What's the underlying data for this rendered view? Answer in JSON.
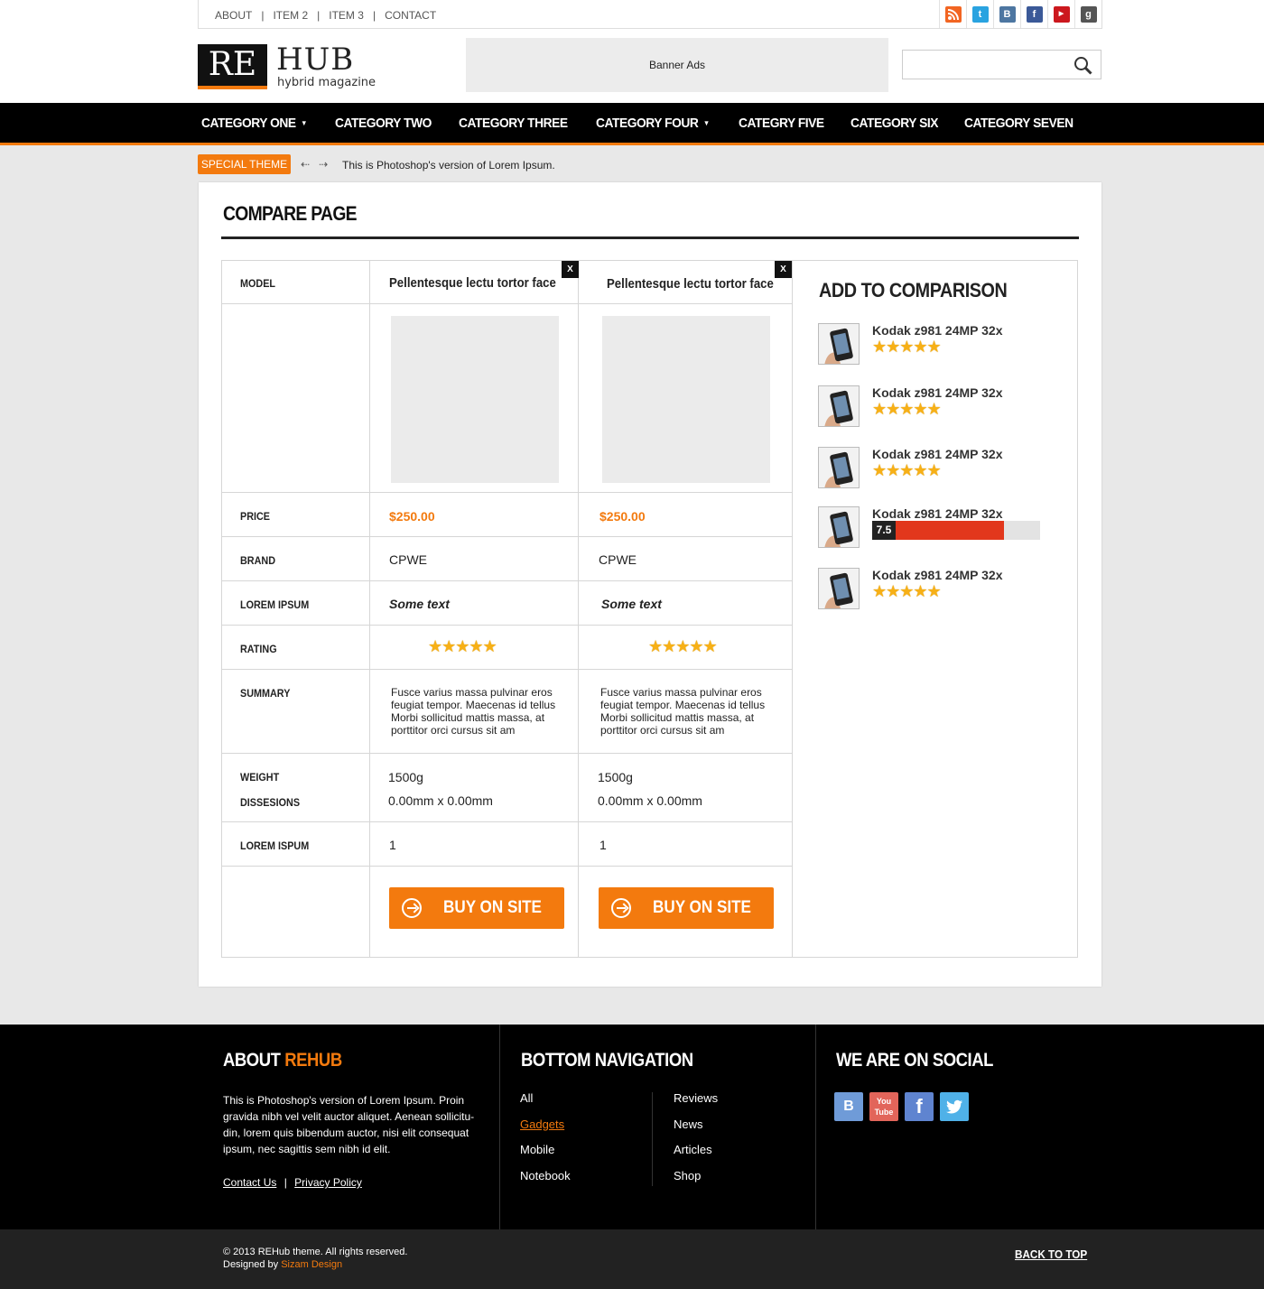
{
  "topbar": {
    "links": [
      "ABOUT",
      "ITEM 2",
      "ITEM 3",
      "CONTACT"
    ],
    "socials": [
      {
        "icon": "rss-icon",
        "color": "#f26522"
      },
      {
        "icon": "twitter-icon",
        "color": "#2aa3e0"
      },
      {
        "icon": "vk-icon",
        "color": "#4d76a1"
      },
      {
        "icon": "facebook-icon",
        "color": "#3b5998"
      },
      {
        "icon": "youtube-icon",
        "color": "#cc181e"
      },
      {
        "icon": "google-plus-icon",
        "color": "#555555"
      }
    ]
  },
  "header": {
    "logo_left": "RE",
    "logo_right": "HUB",
    "tagline": "hybrid magazine",
    "banner": "Banner Ads",
    "search_placeholder": ""
  },
  "nav": {
    "items": [
      {
        "label": "CATEGORY ONE",
        "has_dropdown": true
      },
      {
        "label": "CATEGORY TWO",
        "has_dropdown": false
      },
      {
        "label": "CATEGORY THREE",
        "has_dropdown": false
      },
      {
        "label": "CATEGORY FOUR",
        "has_dropdown": true
      },
      {
        "label": "CATEGRY FIVE",
        "has_dropdown": false
      },
      {
        "label": "CATEGORY SIX",
        "has_dropdown": false
      },
      {
        "label": "CATEGORY SEVEN",
        "has_dropdown": false
      }
    ]
  },
  "ticker": {
    "badge": "SPECIAL THEME",
    "text": "This is Photoshop's version  of Lorem Ipsum."
  },
  "compare": {
    "title": "COMPARE PAGE",
    "labels": {
      "model": "MODEL",
      "price": "PRICE",
      "brand": "BRAND",
      "lorem_ipsum": "LOREM IPSUM",
      "rating": "RATING",
      "summary": "SUMMARY",
      "weight": "WEIGHT",
      "dimensions": "DISSESIONS",
      "lorem_ispum": "LOREM ISPUM"
    },
    "products": [
      {
        "close": "X",
        "model": "Pellentesque lectu tortor face",
        "price": "$250.00",
        "brand": "CPWE",
        "lorem": "Some text",
        "stars": "★★★★★",
        "summary": "Fusce varius massa pulvinar eros feugiat tempor. Maecenas id tellus Morbi sollicitud mattis massa, at porttitor orci cursus sit am",
        "weight": "1500g",
        "dimensions": "0.00mm x 0.00mm",
        "lorem_ispum": "1",
        "buy": "BUY ON SITE"
      },
      {
        "close": "X",
        "model": "Pellentesque lectu tortor face",
        "price": "$250.00",
        "brand": "CPWE",
        "lorem": "Some text",
        "stars": "★★★★★",
        "summary": "Fusce varius massa pulvinar eros feugiat tempor. Maecenas id tellus Morbi sollicitud mattis massa, at porttitor orci cursus sit am",
        "weight": "1500g",
        "dimensions": "0.00mm x 0.00mm",
        "lorem_ispum": "1",
        "buy": "BUY ON SITE"
      }
    ]
  },
  "add_to_comparison": {
    "title": "ADD TO COMPARISON",
    "items": [
      {
        "name": "Kodak z981 24MP 32x",
        "stars": "★★★★★"
      },
      {
        "name": "Kodak z981 24MP 32x",
        "stars": "★★★★★"
      },
      {
        "name": "Kodak z981 24MP 32x",
        "stars": "★★★★★"
      },
      {
        "name": "Kodak z981 24MP 32x",
        "rating": "7.5",
        "rating_fraction": 0.75
      },
      {
        "name": "Kodak z981 24MP 32x",
        "stars": "★★★★★"
      }
    ]
  },
  "footer": {
    "about_title_white": "ABOUT",
    "about_title_orange": "REHUB",
    "about_text": "This is Photoshop's version  of Lorem Ipsum. Proin gravida nibh vel velit auctor aliquet. Aenean sollicitu-din, lorem quis bibendum auctor, nisi elit consequat ipsum, nec sagittis sem nibh id elit.",
    "contact_link": "Contact Us",
    "link_sep": "|",
    "privacy_link": "Privacy Policy",
    "nav_title": "BOTTOM NAVIGATION",
    "nav_col1": [
      "All",
      "Gadgets",
      "Mobile",
      "Notebook"
    ],
    "nav_col2": [
      "Reviews",
      "News",
      "Articles",
      "Shop"
    ],
    "social_title": "WE ARE ON SOCIAL",
    "social_icons": [
      {
        "icon": "vk-icon",
        "color": "#6f9bd8"
      },
      {
        "icon": "youtube-icon",
        "color": "#e2655a"
      },
      {
        "icon": "facebook-icon",
        "color": "#5f84d0"
      },
      {
        "icon": "twitter-icon",
        "color": "#4fb1e8"
      }
    ],
    "copyright": "© 2013 REHub theme. All rights reserved.",
    "designed_by": "Designed by",
    "designer": "Sizam Design",
    "back_to_top": "BACK TO TOP"
  },
  "colors": {
    "accent": "#f37a0e",
    "rating_bar": "#e2371c",
    "star": "#f7b016"
  }
}
